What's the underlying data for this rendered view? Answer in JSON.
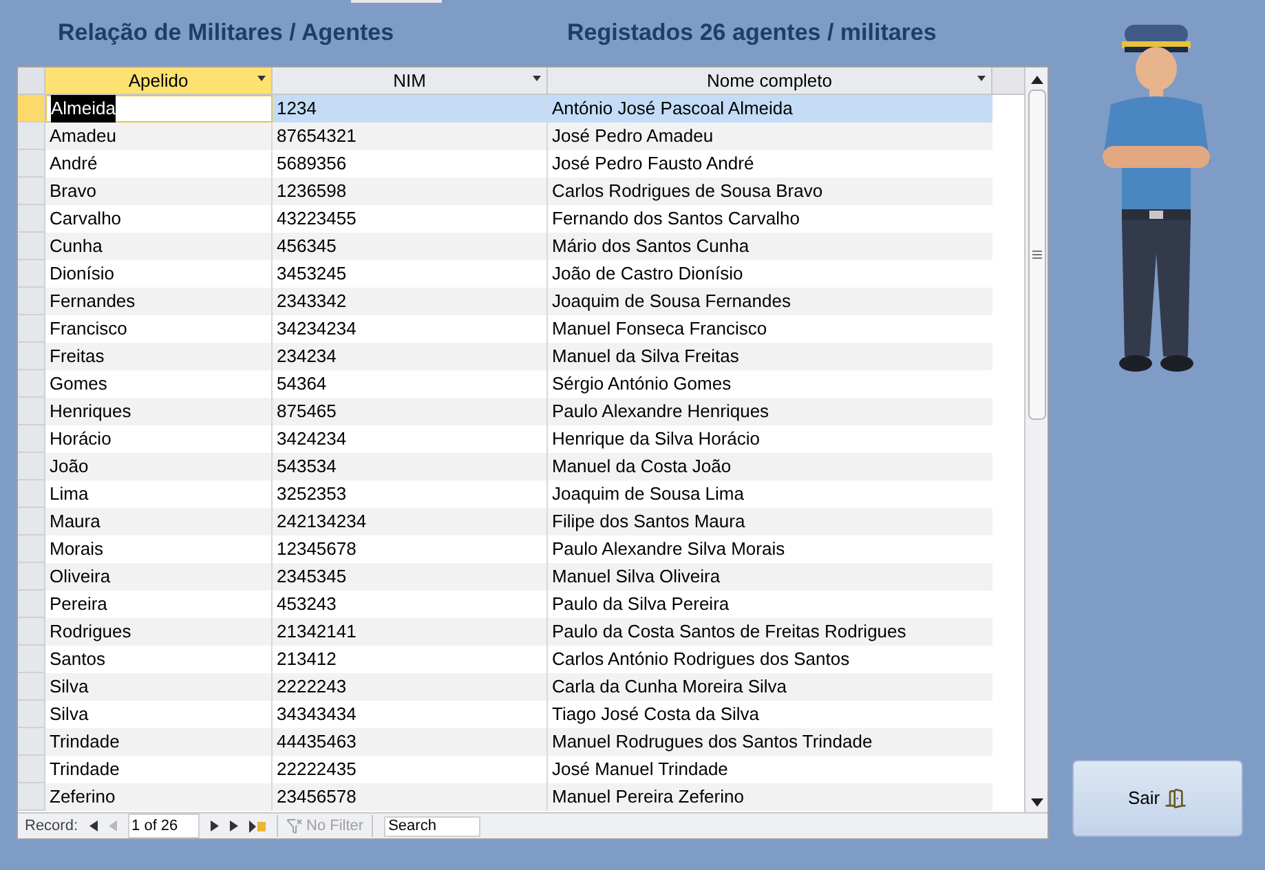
{
  "form": {
    "title": "Relação de Militares / Agentes",
    "summary": "Registados 26 agentes / militares"
  },
  "table": {
    "columns": [
      {
        "label": "Apelido",
        "selected": true
      },
      {
        "label": "NIM",
        "selected": false
      },
      {
        "label": "Nome completo",
        "selected": false
      }
    ],
    "rows": [
      {
        "apelido": "Almeida",
        "nim": "1234",
        "nome": "António José Pascoal Almeida",
        "selected": true
      },
      {
        "apelido": "Amadeu",
        "nim": "87654321",
        "nome": "José Pedro Amadeu",
        "selected": false
      },
      {
        "apelido": "André",
        "nim": "5689356",
        "nome": "José Pedro Fausto André",
        "selected": false
      },
      {
        "apelido": "Bravo",
        "nim": "1236598",
        "nome": "Carlos Rodrigues de Sousa Bravo",
        "selected": false
      },
      {
        "apelido": "Carvalho",
        "nim": "43223455",
        "nome": "Fernando dos Santos Carvalho",
        "selected": false
      },
      {
        "apelido": "Cunha",
        "nim": "456345",
        "nome": "Mário dos Santos Cunha",
        "selected": false
      },
      {
        "apelido": "Dionísio",
        "nim": "3453245",
        "nome": "João de Castro Dionísio",
        "selected": false
      },
      {
        "apelido": "Fernandes",
        "nim": "2343342",
        "nome": "Joaquim de Sousa Fernandes",
        "selected": false
      },
      {
        "apelido": "Francisco",
        "nim": "34234234",
        "nome": "Manuel Fonseca Francisco",
        "selected": false
      },
      {
        "apelido": "Freitas",
        "nim": "234234",
        "nome": "Manuel da Silva Freitas",
        "selected": false
      },
      {
        "apelido": "Gomes",
        "nim": "54364",
        "nome": "Sérgio António Gomes",
        "selected": false
      },
      {
        "apelido": "Henriques",
        "nim": "875465",
        "nome": "Paulo Alexandre Henriques",
        "selected": false
      },
      {
        "apelido": "Horácio",
        "nim": "3424234",
        "nome": "Henrique da Silva Horácio",
        "selected": false
      },
      {
        "apelido": "João",
        "nim": "543534",
        "nome": "Manuel da Costa João",
        "selected": false
      },
      {
        "apelido": "Lima",
        "nim": "3252353",
        "nome": "Joaquim de Sousa Lima",
        "selected": false
      },
      {
        "apelido": "Maura",
        "nim": "242134234",
        "nome": "Filipe dos Santos Maura",
        "selected": false
      },
      {
        "apelido": "Morais",
        "nim": "12345678",
        "nome": "Paulo Alexandre Silva Morais",
        "selected": false
      },
      {
        "apelido": "Oliveira",
        "nim": "2345345",
        "nome": "Manuel Silva Oliveira",
        "selected": false
      },
      {
        "apelido": "Pereira",
        "nim": "453243",
        "nome": "Paulo da Silva Pereira",
        "selected": false
      },
      {
        "apelido": "Rodrigues",
        "nim": "21342141",
        "nome": "Paulo da Costa Santos de Freitas Rodrigues",
        "selected": false
      },
      {
        "apelido": "Santos",
        "nim": "213412",
        "nome": "Carlos António Rodrigues dos Santos",
        "selected": false
      },
      {
        "apelido": "Silva",
        "nim": "2222243",
        "nome": "Carla da Cunha Moreira Silva",
        "selected": false
      },
      {
        "apelido": "Silva",
        "nim": "34343434",
        "nome": "Tiago José Costa da Silva",
        "selected": false
      },
      {
        "apelido": "Trindade",
        "nim": "44435463",
        "nome": "Manuel Rodrugues dos Santos Trindade",
        "selected": false
      },
      {
        "apelido": "Trindade",
        "nim": "22222435",
        "nome": "José Manuel Trindade",
        "selected": false
      },
      {
        "apelido": "Zeferino",
        "nim": "23456578",
        "nome": "Manuel Pereira Zeferino",
        "selected": false
      }
    ]
  },
  "navigator": {
    "label": "Record:",
    "position": "1 of 26",
    "filter": {
      "label": "No Filter",
      "disabled": true
    },
    "search": {
      "placeholder": "Search"
    }
  },
  "exit_button": {
    "label": "Sair"
  }
}
